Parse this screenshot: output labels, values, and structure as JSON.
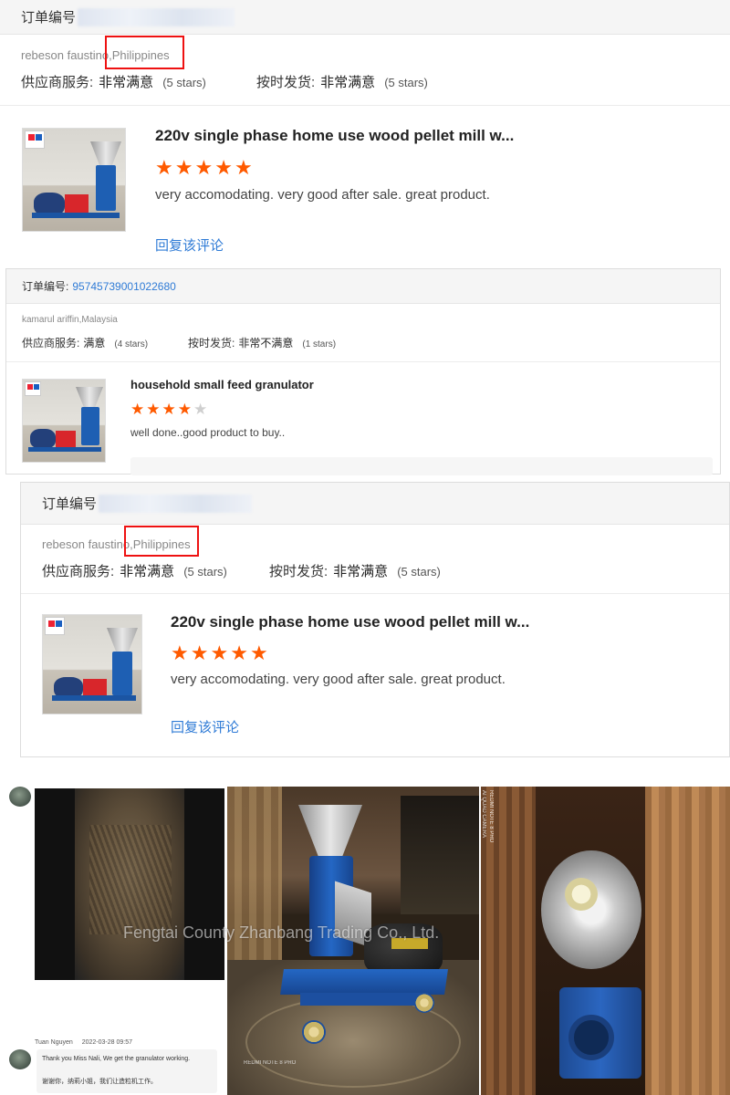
{
  "reviews": [
    {
      "order_label": "订单编号",
      "order_number": "",
      "buyer": "rebeson faustino,Philippines",
      "supplier_service_label": "供应商服务:",
      "supplier_service_value": "非常满意",
      "supplier_service_stars": "(5 stars)",
      "delivery_label": "按时发货:",
      "delivery_value": "非常满意",
      "delivery_stars": "(5 stars)",
      "product_title": "220v single phase home use wood pellet mill w...",
      "rating": 5,
      "comment": "very accomodating. very good after sale. great product.",
      "reply_link": "回复该评论"
    },
    {
      "order_label": "订单编号:",
      "order_number": "95745739001022680",
      "buyer": "kamarul ariffin,Malaysia",
      "supplier_service_label": "供应商服务:",
      "supplier_service_value": "满意",
      "supplier_service_stars": "(4 stars)",
      "delivery_label": "按时发货:",
      "delivery_value": "非常不满意",
      "delivery_stars": "(1 stars)",
      "product_title": "household small feed granulator",
      "rating": 4,
      "comment": "well done..good product to buy.."
    },
    {
      "order_label": "订单编号",
      "order_number": "",
      "buyer": "rebeson faustino,Philippines",
      "supplier_service_label": "供应商服务:",
      "supplier_service_value": "非常满意",
      "supplier_service_stars": "(5 stars)",
      "delivery_label": "按时发货:",
      "delivery_value": "非常满意",
      "delivery_stars": "(5 stars)",
      "product_title": "220v single phase home use wood pellet mill w...",
      "rating": 5,
      "comment": "very accomodating. very good after sale. great product.",
      "reply_link": "回复该评论"
    }
  ],
  "chat": {
    "sender": "Tuan Nguyen",
    "timestamp": "2022-03-28 09:57",
    "message_en": "Thank you Miss Nali, We get the granulator working.",
    "message_zh": "谢谢你，纳莉小姐，我们让造粒机工作。"
  },
  "watermark": "Fengtai County Zhanbang Trading Co., Ltd.",
  "photo_captions": {
    "camera_tag_1": "REDMI NOTE 8 PRO",
    "camera_tag_2": "AI QUAD CAMERA"
  },
  "colors": {
    "star": "#ff5a00",
    "link": "#2f7bd6",
    "highlight": "#ee1111"
  }
}
